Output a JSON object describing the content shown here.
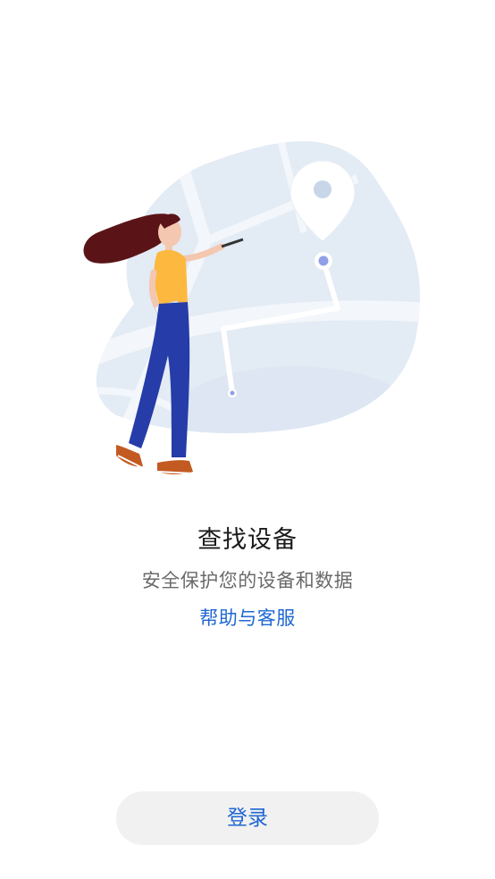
{
  "main": {
    "title": "查找设备",
    "subtitle": "安全保护您的设备和数据",
    "help_link": "帮助与客服"
  },
  "login": {
    "label": "登录"
  },
  "colors": {
    "accent": "#1f67d3",
    "button_bg": "#f1f1f1",
    "map_bg": "#e3ebf4",
    "pin_dot": "#8fa0e8",
    "shirt": "#fdb840",
    "pants": "#263ca8",
    "hair": "#5a1418"
  },
  "illustration": {
    "subject": "map-with-location-pin-and-woman-with-phone"
  }
}
